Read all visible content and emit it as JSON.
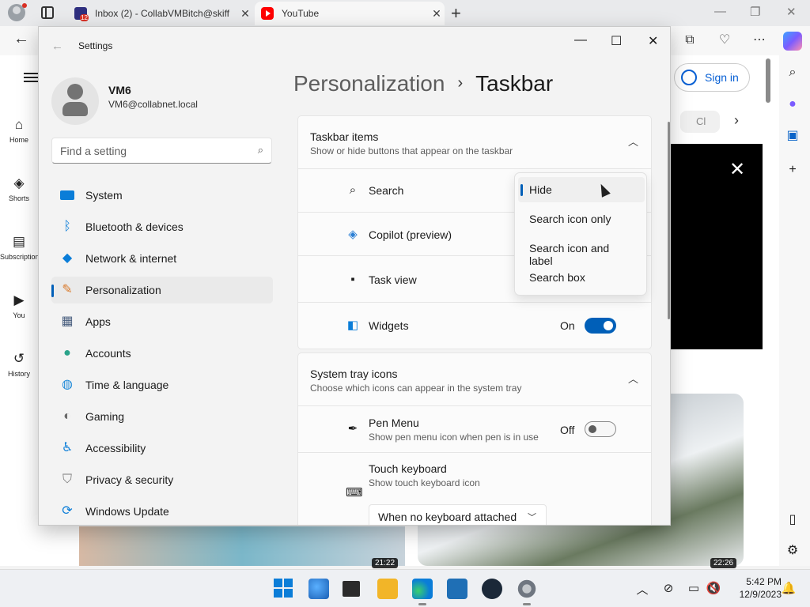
{
  "browser": {
    "tabs": [
      {
        "title": "Inbox (2) - CollabVMBitch@skiff",
        "icon": "mail-icon"
      },
      {
        "title": "YouTube",
        "icon": "youtube-icon"
      }
    ],
    "youtube": {
      "sign_in": "Sign in",
      "sidebar": [
        "Home",
        "Shorts",
        "Subscriptions",
        "You",
        "History"
      ],
      "chip_text": "Cl",
      "durations": [
        "21:22",
        "22:26"
      ]
    }
  },
  "settings": {
    "window_title": "Settings",
    "user": {
      "name": "VM6",
      "email": "VM6@collabnet.local"
    },
    "search_placeholder": "Find a setting",
    "nav": [
      {
        "label": "System",
        "icon": "system-icon"
      },
      {
        "label": "Bluetooth & devices",
        "icon": "bluetooth-icon"
      },
      {
        "label": "Network & internet",
        "icon": "network-icon"
      },
      {
        "label": "Personalization",
        "icon": "brush-icon",
        "active": true
      },
      {
        "label": "Apps",
        "icon": "apps-icon"
      },
      {
        "label": "Accounts",
        "icon": "accounts-icon"
      },
      {
        "label": "Time & language",
        "icon": "globe-icon"
      },
      {
        "label": "Gaming",
        "icon": "gamepad-icon"
      },
      {
        "label": "Accessibility",
        "icon": "accessibility-icon"
      },
      {
        "label": "Privacy & security",
        "icon": "shield-icon"
      },
      {
        "label": "Windows Update",
        "icon": "update-icon"
      }
    ],
    "breadcrumb": {
      "parent": "Personalization",
      "current": "Taskbar"
    },
    "taskbar_items": {
      "title": "Taskbar items",
      "subtitle": "Show or hide buttons that appear on the taskbar",
      "rows": {
        "search": "Search",
        "copilot": "Copilot (preview)",
        "taskview": "Task view",
        "widgets": "Widgets",
        "widgets_state": "On"
      }
    },
    "search_dropdown": {
      "options": [
        "Hide",
        "Search icon only",
        "Search icon and label",
        "Search box"
      ],
      "selected": "Hide"
    },
    "system_tray": {
      "title": "System tray icons",
      "subtitle": "Choose which icons can appear in the system tray",
      "pen": {
        "label": "Pen Menu",
        "sub": "Show pen menu icon when pen is in use",
        "state": "Off"
      },
      "touch": {
        "label": "Touch keyboard",
        "sub": "Show touch keyboard icon",
        "value": "When no keyboard attached"
      }
    }
  },
  "taskbar": {
    "time": "5:42 PM",
    "date": "12/9/2023"
  },
  "colors": {
    "accent": "#005fb8",
    "yt_red": "#ff0000"
  }
}
